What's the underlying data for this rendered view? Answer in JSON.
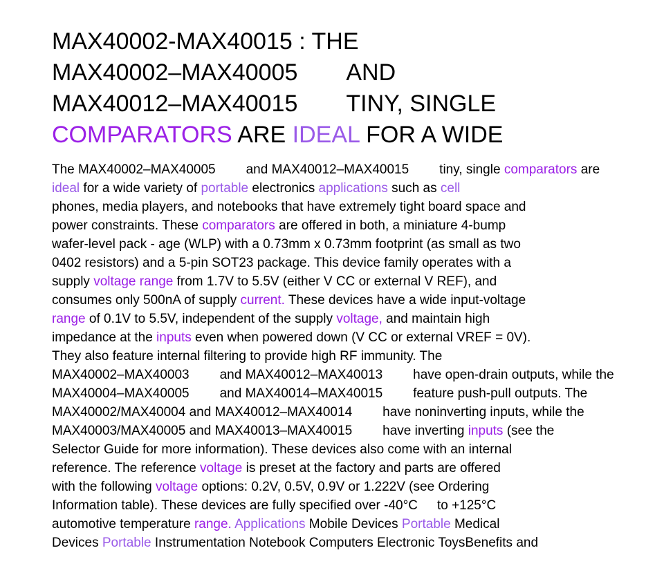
{
  "colors": {
    "text": "#000000",
    "highlight_purple": "#9b20e6",
    "highlight_lavender": "#9a5ae8",
    "background": "#ffffff"
  },
  "title_lines": [
    [
      {
        "t": "MAX40002-MAX40015 : THE",
        "c": ""
      }
    ],
    [
      {
        "t": "MAX40002–MAX40005",
        "c": ""
      },
      {
        "gap": 70
      },
      {
        "t": "AND",
        "c": ""
      }
    ],
    [
      {
        "t": "MAX40012–MAX40015",
        "c": ""
      },
      {
        "gap": 70
      },
      {
        "t": "TINY, SINGLE",
        "c": ""
      }
    ],
    [
      {
        "t": "COMPARATORS",
        "c": "hl-purple"
      },
      {
        "t": " ARE ",
        "c": ""
      },
      {
        "t": "IDEAL",
        "c": "hl-lavender"
      },
      {
        "t": " FOR A WIDE",
        "c": ""
      }
    ]
  ],
  "body_lines": [
    [
      {
        "t": "The MAX40002–MAX40005",
        "c": ""
      },
      {
        "gap": 44
      },
      {
        "t": "and MAX40012–MAX40015",
        "c": ""
      },
      {
        "gap": 44
      },
      {
        "t": "tiny, single ",
        "c": ""
      },
      {
        "t": "comparators",
        "c": "hl-purple"
      },
      {
        "t": " are",
        "c": ""
      }
    ],
    [
      {
        "t": "ideal",
        "c": "hl-lavender"
      },
      {
        "t": " for a wide variety of ",
        "c": ""
      },
      {
        "t": "portable",
        "c": "hl-lavender"
      },
      {
        "t": " electronics ",
        "c": ""
      },
      {
        "t": "applications",
        "c": "hl-lavender"
      },
      {
        "t": " such as ",
        "c": ""
      },
      {
        "t": "cell",
        "c": "hl-lavender"
      }
    ],
    [
      {
        "t": "phones, media players, and notebooks that have extremely tight board space and",
        "c": ""
      }
    ],
    [
      {
        "t": "power constraints. These ",
        "c": ""
      },
      {
        "t": "comparators",
        "c": "hl-purple"
      },
      {
        "t": " are offered in both, a miniature 4-bump",
        "c": ""
      }
    ],
    [
      {
        "t": "wafer-level pack - age (WLP) with a 0.73mm x 0.73mm footprint (as small as two",
        "c": ""
      }
    ],
    [
      {
        "t": "0402 resistors) and a 5-pin SOT23 package. This device family operates with a",
        "c": ""
      }
    ],
    [
      {
        "t": "supply ",
        "c": ""
      },
      {
        "t": "voltage range",
        "c": "hl-purple"
      },
      {
        "t": " from 1.7V to 5.5V (either V CC or external V REF), and",
        "c": ""
      }
    ],
    [
      {
        "t": "consumes only 500nA of supply ",
        "c": ""
      },
      {
        "t": "current.",
        "c": "hl-purple"
      },
      {
        "t": " These devices have a wide input-voltage",
        "c": ""
      }
    ],
    [
      {
        "t": "range",
        "c": "hl-purple"
      },
      {
        "t": " of 0.1V to 5.5V, independent of the supply ",
        "c": ""
      },
      {
        "t": "voltage,",
        "c": "hl-purple"
      },
      {
        "t": " and maintain high",
        "c": ""
      }
    ],
    [
      {
        "t": "impedance at the ",
        "c": ""
      },
      {
        "t": "inputs",
        "c": "hl-purple"
      },
      {
        "t": " even when powered down (V CC or external VREF = 0V).",
        "c": ""
      }
    ],
    [
      {
        "t": "They also feature internal filtering to provide high RF immunity. The",
        "c": ""
      }
    ],
    [
      {
        "t": "MAX40002–MAX40003",
        "c": ""
      },
      {
        "gap": 44
      },
      {
        "t": "and MAX40012–MAX40013",
        "c": ""
      },
      {
        "gap": 44
      },
      {
        "t": "have open-drain outputs, while the",
        "c": ""
      }
    ],
    [
      {
        "t": "MAX40004–MAX40005",
        "c": ""
      },
      {
        "gap": 44
      },
      {
        "t": "and MAX40014–MAX40015",
        "c": ""
      },
      {
        "gap": 44
      },
      {
        "t": "feature push-pull outputs. The",
        "c": ""
      }
    ],
    [
      {
        "t": "MAX40002/MAX40004 and MAX40012–MAX40014",
        "c": ""
      },
      {
        "gap": 44
      },
      {
        "t": "have noninverting inputs, while the",
        "c": ""
      }
    ],
    [
      {
        "t": "MAX40003/MAX40005 and MAX40013–MAX40015",
        "c": ""
      },
      {
        "gap": 44
      },
      {
        "t": "have inverting ",
        "c": ""
      },
      {
        "t": "inputs",
        "c": "hl-purple"
      },
      {
        "t": " (see the",
        "c": ""
      }
    ],
    [
      {
        "t": "Selector Guide for more information). These devices also come with an internal",
        "c": ""
      }
    ],
    [
      {
        "t": "reference. The reference ",
        "c": ""
      },
      {
        "t": "voltage",
        "c": "hl-purple"
      },
      {
        "t": " is preset at the factory and parts are offered",
        "c": ""
      }
    ],
    [
      {
        "t": "with the following ",
        "c": ""
      },
      {
        "t": "voltage",
        "c": "hl-purple"
      },
      {
        "t": " options: 0.2V, 0.5V, 0.9V or 1.222V (see Ordering",
        "c": ""
      }
    ],
    [
      {
        "t": "Information table). These devices are fully specified over -40°C",
        "c": ""
      },
      {
        "gap": 28
      },
      {
        "t": "to +125°C",
        "c": ""
      }
    ],
    [
      {
        "t": "automotive temperature ",
        "c": ""
      },
      {
        "t": "range.",
        "c": "hl-purple"
      },
      {
        "t": " ",
        "c": ""
      },
      {
        "t": "Applications",
        "c": "hl-lavender"
      },
      {
        "t": " Mobile Devices ",
        "c": ""
      },
      {
        "t": "Portable",
        "c": "hl-lavender"
      },
      {
        "t": " Medical",
        "c": ""
      }
    ],
    [
      {
        "t": "Devices ",
        "c": ""
      },
      {
        "t": "Portable",
        "c": "hl-lavender"
      },
      {
        "t": " Instrumentation Notebook Computers Electronic ToysBenefits and",
        "c": ""
      }
    ]
  ]
}
